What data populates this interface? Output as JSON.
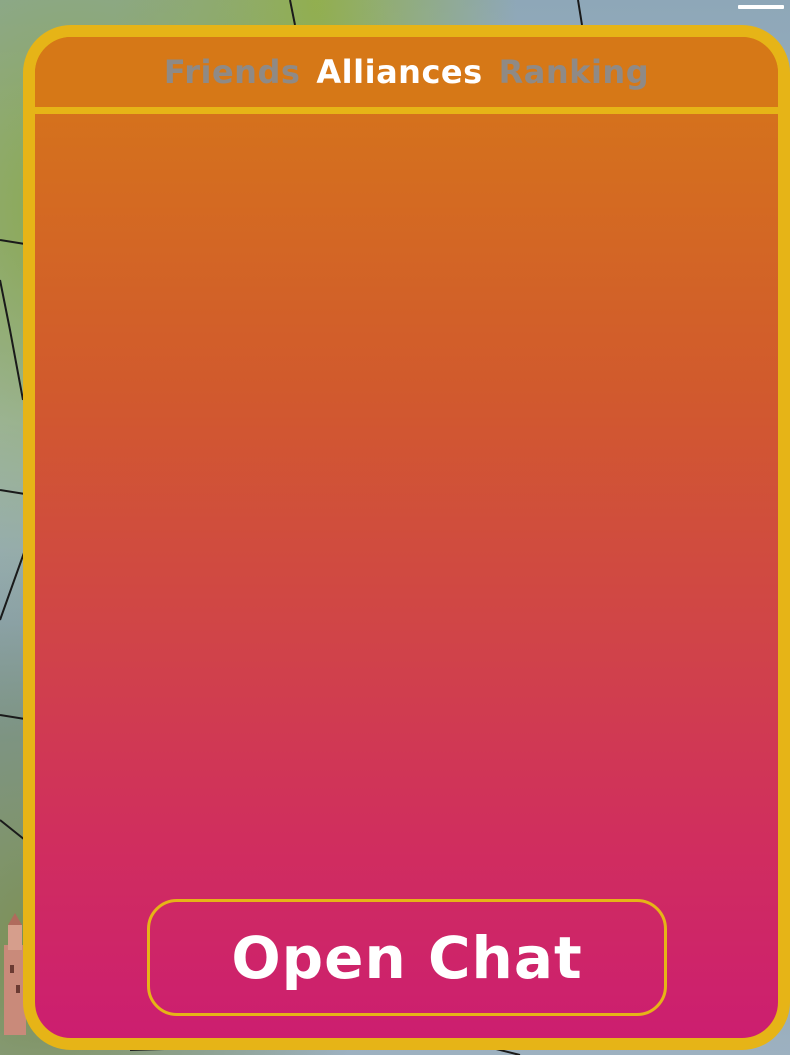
{
  "tabs": [
    {
      "label": "Friends",
      "active": false
    },
    {
      "label": "Alliances",
      "active": true
    },
    {
      "label": "Ranking",
      "active": false
    }
  ],
  "chat_button": {
    "label": "Open Chat"
  },
  "colors": {
    "panel_border": "#e6b417",
    "panel_top": "#d67818",
    "panel_bottom": "#cc1e70",
    "tab_active": "#ffffff",
    "tab_inactive": "#8f8a86"
  },
  "icons": {
    "menu": "menu-bar-icon"
  }
}
